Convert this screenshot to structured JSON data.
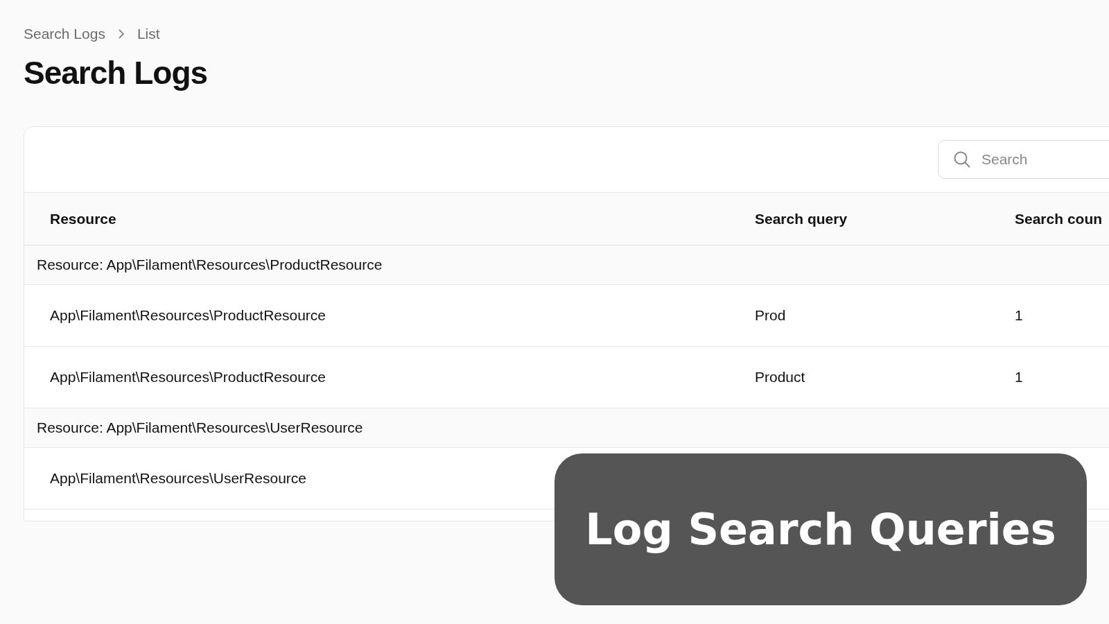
{
  "breadcrumbs": [
    "Search Logs",
    "List"
  ],
  "title": "Search Logs",
  "search": {
    "placeholder": "Search"
  },
  "table": {
    "columns": [
      "Resource",
      "Search query",
      "Search coun"
    ],
    "groups": [
      {
        "label": "Resource: App\\Filament\\Resources\\ProductResource",
        "rows": [
          {
            "resource": "App\\Filament\\Resources\\ProductResource",
            "query": "Prod",
            "count": "1"
          },
          {
            "resource": "App\\Filament\\Resources\\ProductResource",
            "query": "Product",
            "count": "1"
          }
        ]
      },
      {
        "label": "Resource: App\\Filament\\Resources\\UserResource",
        "rows": [
          {
            "resource": "App\\Filament\\Resources\\UserResource"
          }
        ]
      }
    ]
  },
  "banner": {
    "text": "Log Search Queries"
  }
}
